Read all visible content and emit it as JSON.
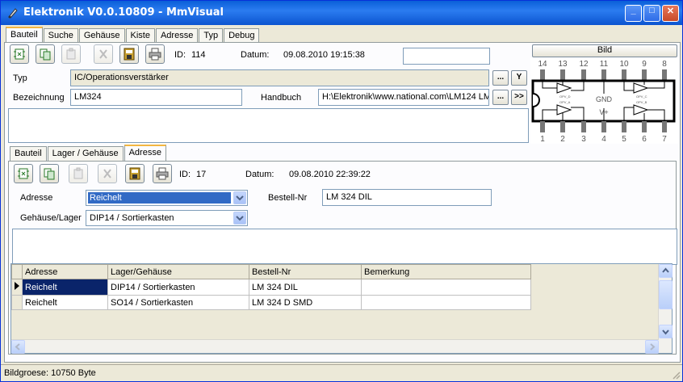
{
  "window": {
    "title": "Elektronik V0.0.10809  - MmVisual",
    "buttons": {
      "minimize": "_",
      "maximize": "□",
      "close": "✕"
    }
  },
  "main_tabs": [
    "Bauteil",
    "Suche",
    "Gehäuse",
    "Kiste",
    "Adresse",
    "Typ",
    "Debug"
  ],
  "main_active_tab": "Bauteil",
  "bauteil": {
    "id_label": "ID:",
    "id_value": "114",
    "datum_label": "Datum:",
    "datum_value": "09.08.2010 19:15:38",
    "extra_field": "",
    "typ_label": "Typ",
    "typ_value": "IC/Operationsverstärker",
    "typ_btn_dots": "...",
    "typ_btn_y": "Y",
    "bezeichnung_label": "Bezeichnung",
    "bezeichnung_value": "LM324",
    "handbuch_label": "Handbuch",
    "handbuch_value": "H:\\Elektronik\\www.national.com\\LM124 LM",
    "handbuch_btn_dots": "...",
    "handbuch_btn_next": ">>",
    "notes": "",
    "bild_button": "Bild",
    "pinout": {
      "top_pins": [
        "14",
        "13",
        "12",
        "11",
        "10",
        "9",
        "8"
      ],
      "bottom_pins": [
        "1",
        "2",
        "3",
        "4",
        "5",
        "6",
        "7"
      ],
      "gnd_label": "GND",
      "vplus_label": "V+",
      "opamp_labels": [
        "OPV_D",
        "OPV_C",
        "OPV_A",
        "OPV_B"
      ]
    }
  },
  "sub_tabs": [
    "Bauteil",
    "Lager / Gehäuse",
    "Adresse"
  ],
  "sub_active_tab": "Adresse",
  "adresse": {
    "id_label": "ID:",
    "id_value": "17",
    "datum_label": "Datum:",
    "datum_value": "09.08.2010 22:39:22",
    "adresse_label": "Adresse",
    "adresse_value": "Reichelt",
    "bestell_label": "Bestell-Nr",
    "bestell_value": "LM 324 DIL",
    "gehaeuse_label": "Gehäuse/Lager",
    "gehaeuse_value": "DIP14 / Sortierkasten",
    "notes": ""
  },
  "grid": {
    "columns": [
      "Adresse",
      "Lager/Gehäuse",
      "Bestell-Nr",
      "Bemerkung"
    ],
    "rows": [
      [
        "Reichelt",
        "DIP14 / Sortierkasten",
        "LM 324 DIL",
        ""
      ],
      [
        "Reichelt",
        "SO14 / Sortierkasten",
        "LM 324 D SMD",
        ""
      ]
    ]
  },
  "status": {
    "text": "Bildgroese: 10750 Byte"
  },
  "icons": {
    "toolbar": [
      "new-icon",
      "copy-icon",
      "paste-icon",
      "delete-icon",
      "save-icon",
      "print-icon"
    ]
  },
  "colors": {
    "titlebar": "#0a5fd8",
    "selection": "#316ac5",
    "grid_current": "#0a246a",
    "tab_highlight": "#f3b641"
  }
}
